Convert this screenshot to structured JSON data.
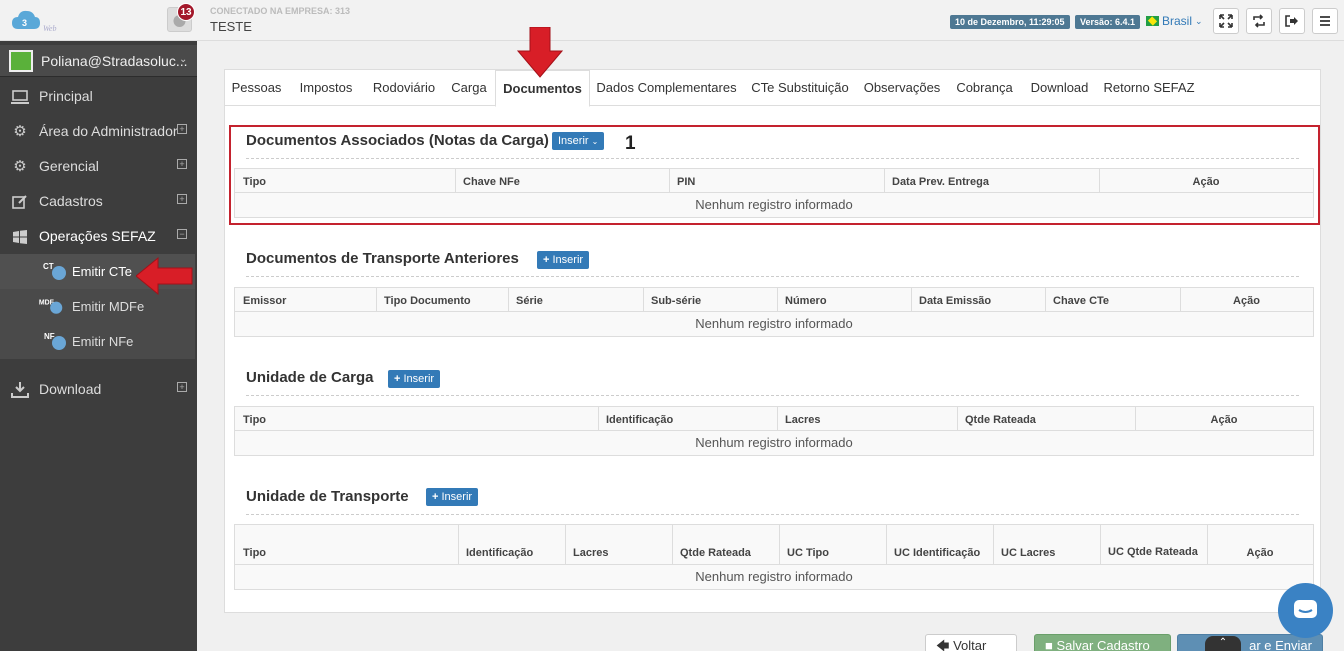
{
  "topbar": {
    "logo_text": "Web",
    "notification_count": "13",
    "company_label": "CONECTADO NA EMPRESA: 313",
    "company_name": "TESTE",
    "datetime": "10 de Dezembro, 11:29:05",
    "version": "Versão: 6.4.1",
    "language": "Brasil"
  },
  "sidebar": {
    "user": "Poliana@Stradasoluc...",
    "items": [
      {
        "label": "Principal",
        "icon": "monitor-icon"
      },
      {
        "label": "Área do Administrador",
        "icon": "gears-icon"
      },
      {
        "label": "Gerencial",
        "icon": "gears-icon"
      },
      {
        "label": "Cadastros",
        "icon": "edit-icon"
      },
      {
        "label": "Operações SEFAZ",
        "icon": "windows-icon"
      },
      {
        "label": "Download",
        "icon": "download-icon"
      }
    ],
    "subitems": [
      {
        "label": "Emitir CTe",
        "badge": "CT"
      },
      {
        "label": "Emitir MDFe",
        "badge": "MDF"
      },
      {
        "label": "Emitir NFe",
        "badge": "NF"
      }
    ]
  },
  "tabs": [
    "Pessoas",
    "Impostos",
    "Rodoviário",
    "Carga",
    "Documentos",
    "Dados Complementares",
    "CTe Substituição",
    "Observações",
    "Cobrança",
    "Download",
    "Retorno SEFAZ"
  ],
  "sections": {
    "assoc": {
      "title": "Documentos Associados (Notas da Carga)",
      "button": "Inserir",
      "columns": [
        "Tipo",
        "Chave NFe",
        "PIN",
        "Data Prev. Entrega",
        "Ação"
      ],
      "empty": "Nenhum registro informado"
    },
    "anteriores": {
      "title": "Documentos de Transporte Anteriores",
      "button": "Inserir",
      "columns": [
        "Emissor",
        "Tipo Documento",
        "Série",
        "Sub-série",
        "Número",
        "Data Emissão",
        "Chave CTe",
        "Ação"
      ],
      "empty": "Nenhum registro informado"
    },
    "unid_carga": {
      "title": "Unidade de Carga",
      "button": "Inserir",
      "columns": [
        "Tipo",
        "Identificação",
        "Lacres",
        "Qtde Rateada",
        "Ação"
      ],
      "empty": "Nenhum registro informado"
    },
    "unid_transp": {
      "title": "Unidade de Transporte",
      "button": "Inserir",
      "columns": [
        "Tipo",
        "Identificação",
        "Lacres",
        "Qtde Rateada",
        "UC Tipo",
        "UC Identificação",
        "UC Lacres",
        "UC Qtde Rateada",
        "Ação"
      ],
      "empty": "Nenhum registro informado"
    }
  },
  "annotation": "1",
  "footer": {
    "back": "Voltar",
    "save": "Salvar Cadastro",
    "send": "ar e Enviar"
  },
  "colors": {
    "accent": "#337ab7",
    "highlight": "#c4222e",
    "sidebar": "#3d3d3d"
  }
}
